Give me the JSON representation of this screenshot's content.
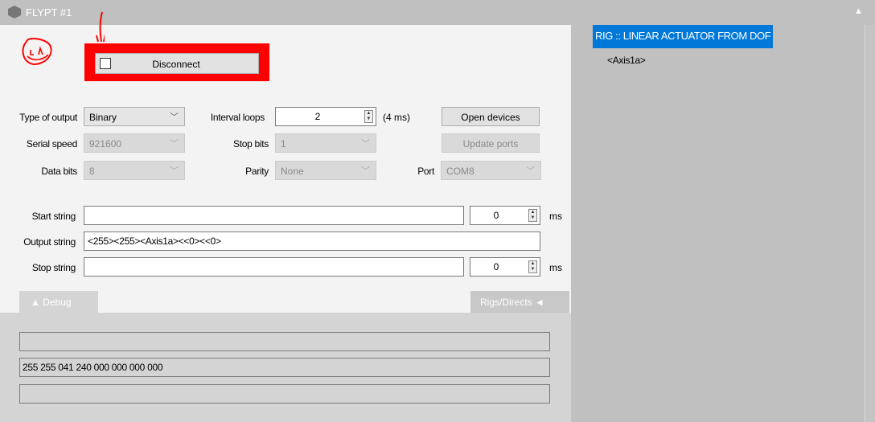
{
  "window": {
    "title": "FLYPT #1",
    "collapse_icon": "triangle-up"
  },
  "connection": {
    "checked": false,
    "button_label": "Disconnect"
  },
  "annotation": {
    "color": "#ff0000"
  },
  "settings": {
    "type_of_output": {
      "label": "Type of output",
      "value": "Binary"
    },
    "serial_speed": {
      "label": "Serial speed",
      "value": "921600"
    },
    "data_bits": {
      "label": "Data bits",
      "value": "8"
    },
    "interval_loops": {
      "label": "Interval loops",
      "value": "2",
      "suffix": "(4 ms)"
    },
    "stop_bits": {
      "label": "Stop bits",
      "value": "1"
    },
    "parity": {
      "label": "Parity",
      "value": "None"
    },
    "port": {
      "label": "Port",
      "value": "COM8"
    },
    "open_devices": "Open devices",
    "update_ports": "Update ports"
  },
  "strings": {
    "start": {
      "label": "Start string",
      "value": "",
      "delay": "0",
      "unit": "ms"
    },
    "output": {
      "label": "Output string",
      "value": "<255><255><Axis1a><<0><<0>"
    },
    "stop": {
      "label": "Stop string",
      "value": "",
      "delay": "0",
      "unit": "ms"
    }
  },
  "tabs": {
    "debug": "▲  Debug",
    "rigs": "Rigs/Directs  ◄"
  },
  "debug": {
    "lines": [
      "",
      "255 255 041 240 000 000 000 000",
      ""
    ]
  },
  "rig_panel": {
    "title": "RIG :: LINEAR ACTUATOR FROM DOF",
    "items": [
      "<Axis1a>"
    ],
    "highlight": "#0078d7"
  }
}
